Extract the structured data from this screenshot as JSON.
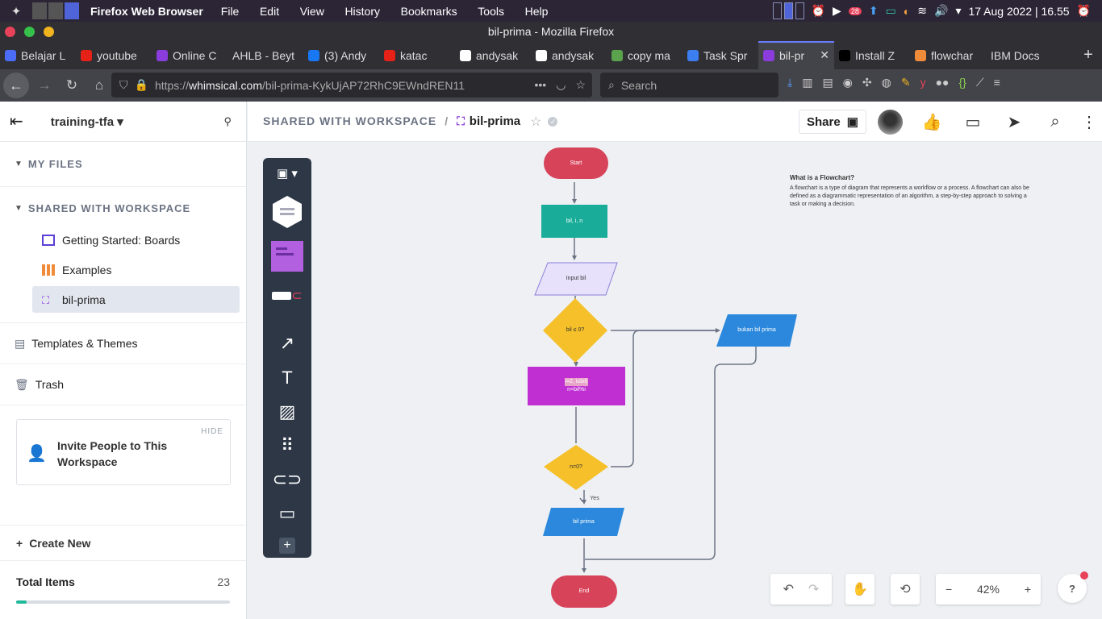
{
  "system": {
    "app_name": "Firefox Web Browser",
    "menu": [
      "File",
      "Edit",
      "View",
      "History",
      "Bookmarks",
      "Tools",
      "Help"
    ],
    "battery": "28",
    "datetime": "17 Aug 2022 | 16.55"
  },
  "window": {
    "title": "bil-prima - Mozilla Firefox"
  },
  "tabs": [
    {
      "label": "Belajar L",
      "color": "#4a6cf7"
    },
    {
      "label": "youtube",
      "color": "#e62117"
    },
    {
      "label": "Online C",
      "color": "#8a3ddc"
    },
    {
      "label": "AHLB - Beyt",
      "color": ""
    },
    {
      "label": "(3) Andy",
      "color": "#1877f2"
    },
    {
      "label": "katac",
      "color": "#e62117"
    },
    {
      "label": "andysak",
      "color": "#ffffff"
    },
    {
      "label": "andysak",
      "color": "#ffffff"
    },
    {
      "label": "copy ma",
      "color": "#5aa34c"
    },
    {
      "label": "Task Spr",
      "color": "#3c7df0"
    },
    {
      "label": "bil-pr",
      "color": "#8a3ddc"
    },
    {
      "label": "Install Z",
      "color": "#000000"
    },
    {
      "label": "flowchar",
      "color": "#f08b3a"
    },
    {
      "label": "IBM Docs",
      "color": ""
    }
  ],
  "nav": {
    "url_prefix": "https://",
    "url_host": "whimsical.com",
    "url_path": "/bil-prima-KykUjAP72RhC9EWndREN11",
    "search_placeholder": "Search"
  },
  "sidebar": {
    "workspace": "training-tfa",
    "my_files": "MY FILES",
    "shared": "SHARED WITH WORKSPACE",
    "items": [
      {
        "label": "Getting Started: Boards"
      },
      {
        "label": "Examples"
      },
      {
        "label": "bil-prima"
      }
    ],
    "templates": "Templates & Themes",
    "trash": "Trash",
    "invite": {
      "text": "Invite People to This Workspace",
      "hide": "HIDE"
    },
    "create_new": "Create New",
    "total_label": "Total Items",
    "total_count": "23",
    "usage_fraction": 0.05
  },
  "header": {
    "breadcrumb_parent": "SHARED WITH WORKSPACE",
    "separator": "/",
    "doc_title": "bil-prima",
    "share_label": "Share"
  },
  "flowchart": {
    "start": "Start",
    "vars": "bil, i, n",
    "input": "Input bil",
    "cond1": "bil ≤ 0?",
    "not_prime": "bukan bil prima",
    "loop_line1": "i=2, i≤bil)",
    "loop_line2": "n=bil%i",
    "cond2": "n=0?",
    "yes": "Yes",
    "prime": "bil prima",
    "end": "End"
  },
  "note": {
    "heading": "What is a Flowchart?",
    "body": "A flowchart is a type of diagram that represents a workflow or a process. A flowchart can also be defined as a diagrammatic representation of an algorithm, a step-by-step approach to solving a task or making a decision."
  },
  "zoom": {
    "level": "42%",
    "minus": "−",
    "plus": "+"
  },
  "help": "?"
}
